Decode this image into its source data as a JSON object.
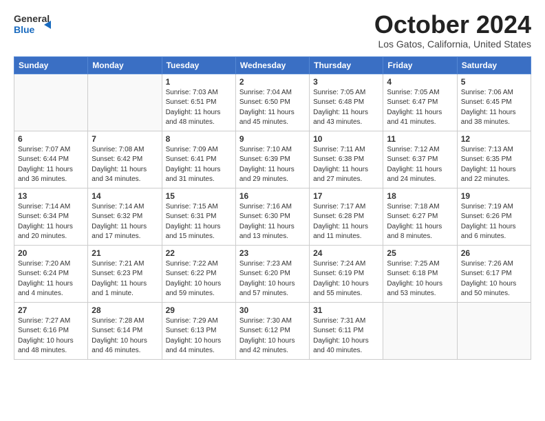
{
  "logo": {
    "line1": "General",
    "line2": "Blue"
  },
  "title": "October 2024",
  "location": "Los Gatos, California, United States",
  "weekdays": [
    "Sunday",
    "Monday",
    "Tuesday",
    "Wednesday",
    "Thursday",
    "Friday",
    "Saturday"
  ],
  "weeks": [
    [
      {
        "day": "",
        "detail": ""
      },
      {
        "day": "",
        "detail": ""
      },
      {
        "day": "1",
        "detail": "Sunrise: 7:03 AM\nSunset: 6:51 PM\nDaylight: 11 hours and 48 minutes."
      },
      {
        "day": "2",
        "detail": "Sunrise: 7:04 AM\nSunset: 6:50 PM\nDaylight: 11 hours and 45 minutes."
      },
      {
        "day": "3",
        "detail": "Sunrise: 7:05 AM\nSunset: 6:48 PM\nDaylight: 11 hours and 43 minutes."
      },
      {
        "day": "4",
        "detail": "Sunrise: 7:05 AM\nSunset: 6:47 PM\nDaylight: 11 hours and 41 minutes."
      },
      {
        "day": "5",
        "detail": "Sunrise: 7:06 AM\nSunset: 6:45 PM\nDaylight: 11 hours and 38 minutes."
      }
    ],
    [
      {
        "day": "6",
        "detail": "Sunrise: 7:07 AM\nSunset: 6:44 PM\nDaylight: 11 hours and 36 minutes."
      },
      {
        "day": "7",
        "detail": "Sunrise: 7:08 AM\nSunset: 6:42 PM\nDaylight: 11 hours and 34 minutes."
      },
      {
        "day": "8",
        "detail": "Sunrise: 7:09 AM\nSunset: 6:41 PM\nDaylight: 11 hours and 31 minutes."
      },
      {
        "day": "9",
        "detail": "Sunrise: 7:10 AM\nSunset: 6:39 PM\nDaylight: 11 hours and 29 minutes."
      },
      {
        "day": "10",
        "detail": "Sunrise: 7:11 AM\nSunset: 6:38 PM\nDaylight: 11 hours and 27 minutes."
      },
      {
        "day": "11",
        "detail": "Sunrise: 7:12 AM\nSunset: 6:37 PM\nDaylight: 11 hours and 24 minutes."
      },
      {
        "day": "12",
        "detail": "Sunrise: 7:13 AM\nSunset: 6:35 PM\nDaylight: 11 hours and 22 minutes."
      }
    ],
    [
      {
        "day": "13",
        "detail": "Sunrise: 7:14 AM\nSunset: 6:34 PM\nDaylight: 11 hours and 20 minutes."
      },
      {
        "day": "14",
        "detail": "Sunrise: 7:14 AM\nSunset: 6:32 PM\nDaylight: 11 hours and 17 minutes."
      },
      {
        "day": "15",
        "detail": "Sunrise: 7:15 AM\nSunset: 6:31 PM\nDaylight: 11 hours and 15 minutes."
      },
      {
        "day": "16",
        "detail": "Sunrise: 7:16 AM\nSunset: 6:30 PM\nDaylight: 11 hours and 13 minutes."
      },
      {
        "day": "17",
        "detail": "Sunrise: 7:17 AM\nSunset: 6:28 PM\nDaylight: 11 hours and 11 minutes."
      },
      {
        "day": "18",
        "detail": "Sunrise: 7:18 AM\nSunset: 6:27 PM\nDaylight: 11 hours and 8 minutes."
      },
      {
        "day": "19",
        "detail": "Sunrise: 7:19 AM\nSunset: 6:26 PM\nDaylight: 11 hours and 6 minutes."
      }
    ],
    [
      {
        "day": "20",
        "detail": "Sunrise: 7:20 AM\nSunset: 6:24 PM\nDaylight: 11 hours and 4 minutes."
      },
      {
        "day": "21",
        "detail": "Sunrise: 7:21 AM\nSunset: 6:23 PM\nDaylight: 11 hours and 1 minute."
      },
      {
        "day": "22",
        "detail": "Sunrise: 7:22 AM\nSunset: 6:22 PM\nDaylight: 10 hours and 59 minutes."
      },
      {
        "day": "23",
        "detail": "Sunrise: 7:23 AM\nSunset: 6:20 PM\nDaylight: 10 hours and 57 minutes."
      },
      {
        "day": "24",
        "detail": "Sunrise: 7:24 AM\nSunset: 6:19 PM\nDaylight: 10 hours and 55 minutes."
      },
      {
        "day": "25",
        "detail": "Sunrise: 7:25 AM\nSunset: 6:18 PM\nDaylight: 10 hours and 53 minutes."
      },
      {
        "day": "26",
        "detail": "Sunrise: 7:26 AM\nSunset: 6:17 PM\nDaylight: 10 hours and 50 minutes."
      }
    ],
    [
      {
        "day": "27",
        "detail": "Sunrise: 7:27 AM\nSunset: 6:16 PM\nDaylight: 10 hours and 48 minutes."
      },
      {
        "day": "28",
        "detail": "Sunrise: 7:28 AM\nSunset: 6:14 PM\nDaylight: 10 hours and 46 minutes."
      },
      {
        "day": "29",
        "detail": "Sunrise: 7:29 AM\nSunset: 6:13 PM\nDaylight: 10 hours and 44 minutes."
      },
      {
        "day": "30",
        "detail": "Sunrise: 7:30 AM\nSunset: 6:12 PM\nDaylight: 10 hours and 42 minutes."
      },
      {
        "day": "31",
        "detail": "Sunrise: 7:31 AM\nSunset: 6:11 PM\nDaylight: 10 hours and 40 minutes."
      },
      {
        "day": "",
        "detail": ""
      },
      {
        "day": "",
        "detail": ""
      }
    ]
  ]
}
